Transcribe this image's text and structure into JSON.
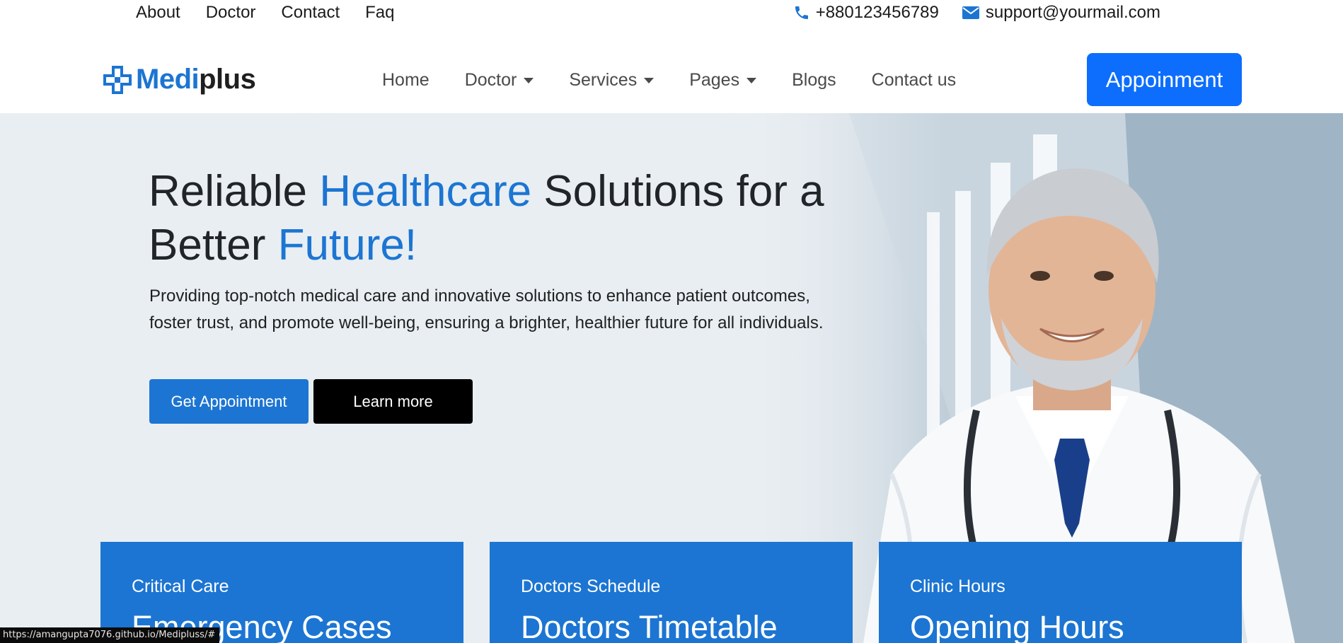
{
  "topbar": {
    "links": [
      "About",
      "Doctor",
      "Contact",
      "Faq"
    ],
    "phone": "+880123456789",
    "email": "support@yourmail.com"
  },
  "navbar": {
    "logo": {
      "part1": "Medi",
      "part2": "plus"
    },
    "menu": [
      {
        "label": "Home",
        "dropdown": false
      },
      {
        "label": "Doctor",
        "dropdown": true
      },
      {
        "label": "Services",
        "dropdown": true
      },
      {
        "label": "Pages",
        "dropdown": true
      },
      {
        "label": "Blogs",
        "dropdown": false
      },
      {
        "label": "Contact us",
        "dropdown": false
      }
    ],
    "cta": "Appoinment"
  },
  "hero": {
    "headline": {
      "w1": "Reliable ",
      "w2": "Healthcare",
      "w3": " Solutions for a",
      "w4": "Better ",
      "w5": "Future!"
    },
    "description": "Providing top-notch medical care and innovative solutions to enhance patient outcomes, foster trust, and promote well-being, ensuring a brighter, healthier future for all individuals.",
    "primary_button": "Get Appointment",
    "secondary_button": "Learn more"
  },
  "cards": [
    {
      "kicker": "Critical Care",
      "title": "Emergency Cases"
    },
    {
      "kicker": "Doctors Schedule",
      "title": "Doctors Timetable"
    },
    {
      "kicker": "Clinic Hours",
      "title": "Opening Hours"
    }
  ],
  "statusbar": {
    "url": "https://amangupta7076.github.io/Medipluss/#"
  },
  "colors": {
    "accent": "#1c75d2",
    "primary_button": "#0d6efd",
    "dark_button": "#000000"
  }
}
